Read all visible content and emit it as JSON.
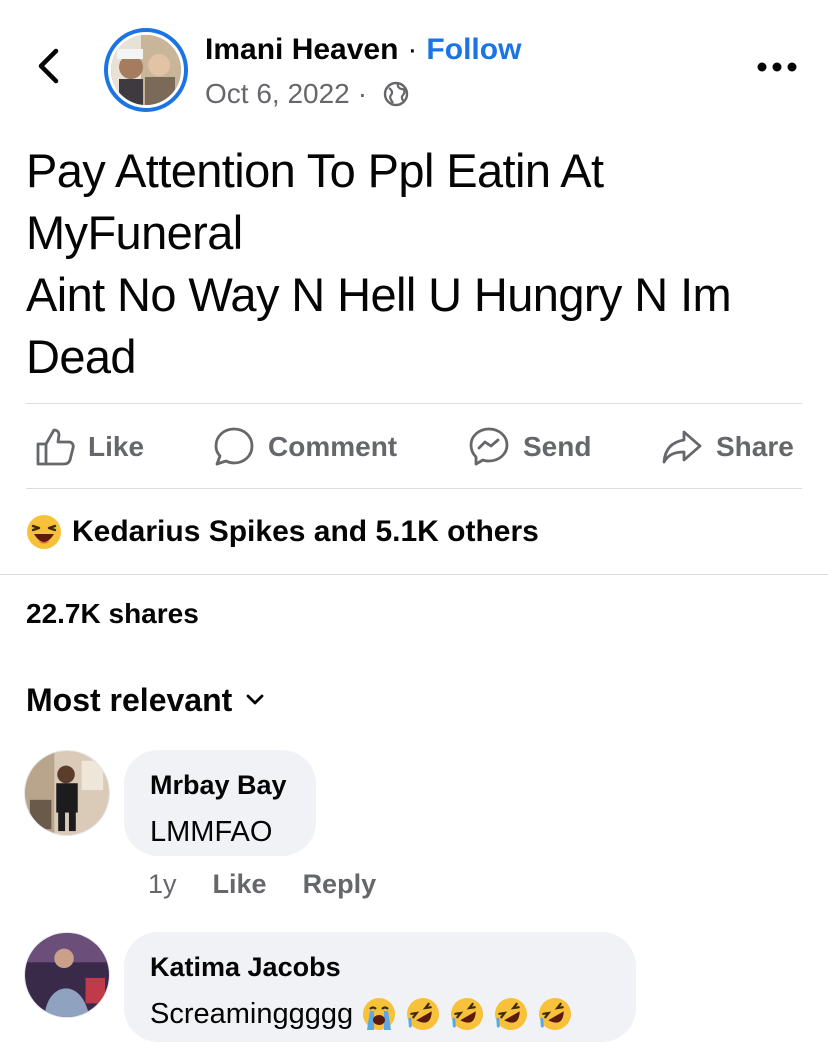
{
  "header": {
    "author_name": "Imani Heaven",
    "separator": "·",
    "follow_label": "Follow",
    "date": "Oct 6, 2022",
    "date_separator": "·",
    "privacy_icon": "globe-icon",
    "back_icon": "chevron-left-icon",
    "more_icon": "more-horizontal-icon"
  },
  "post": {
    "lines": [
      "Pay Attention To Ppl Eatin At",
      "MyFuneral",
      "Aint No Way N Hell U Hungry N Im",
      "Dead"
    ]
  },
  "actions": {
    "like": "Like",
    "comment": "Comment",
    "send": "Send",
    "share": "Share"
  },
  "reactions": {
    "emoji": "laughing-squinting-face",
    "text": "Kedarius Spikes and 5.1K others"
  },
  "shares": "22.7K shares",
  "sort": {
    "label": "Most relevant",
    "icon": "chevron-down-icon"
  },
  "comments": [
    {
      "name": "Mrbay Bay",
      "text": "LMMFAO",
      "time": "1y",
      "like_label": "Like",
      "reply_label": "Reply"
    },
    {
      "name": "Katima Jacobs",
      "text": "Screaminggggg",
      "emojis": [
        "loudly-crying-face",
        "rolling-on-floor-laughing",
        "rolling-on-floor-laughing",
        "rolling-on-floor-laughing",
        "rolling-on-floor-laughing"
      ]
    }
  ],
  "colors": {
    "accent": "#1b74e4",
    "secondary_text": "#65676b",
    "primary_text": "#050505",
    "bubble": "#f0f2f5",
    "divider": "#dadde1"
  }
}
